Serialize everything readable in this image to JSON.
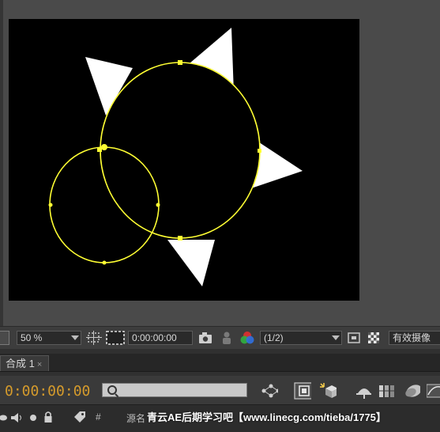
{
  "viewer": {
    "background_color": "#000000",
    "shape_color": "#ffffff",
    "path_color": "#ffff33"
  },
  "viewer_toolbar": {
    "zoom_label": "50 %",
    "timecode": "0:00:00:00",
    "resolution_label": "(1/2)",
    "camera_label": "有效摄像"
  },
  "timeline": {
    "tab_label": "合成 1",
    "tab_close": "×",
    "current_time": "0:00:00:00",
    "header_hash": "#",
    "header_source": "源名",
    "watermark": "青云AE后期学习吧【www.linecg.com/tieba/1775】"
  },
  "icons": [
    "toggle-mask-icon",
    "grid-icon",
    "snapshot-icon",
    "show-snapshot-icon",
    "color-channel-icon",
    "region-of-interest-icon",
    "transparency-grid-icon",
    "search-icon",
    "composition-mini-flowchart-icon",
    "draft-3d-icon",
    "shy-layers-icon",
    "frame-blending-icon",
    "motion-blur-icon",
    "graph-editor-icon",
    "audio-icon",
    "solo-icon",
    "lock-icon",
    "label-icon"
  ]
}
